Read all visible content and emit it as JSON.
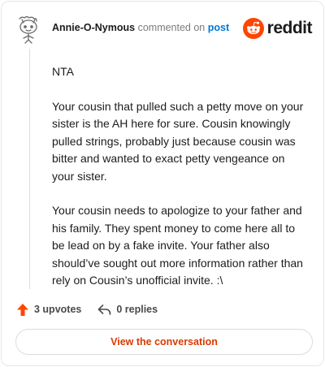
{
  "header": {
    "author": "Annie-O-Nymous",
    "action_text": "commented on",
    "post_link": "post",
    "brand": "reddit"
  },
  "comment": {
    "paragraphs": [
      "NTA",
      "Your cousin that pulled such a petty move on your sister is the AH here for sure. Cousin knowingly pulled strings, probably just because cousin was bitter and wanted to exact petty vengeance on your sister.",
      "Your cousin needs to apologize to your father and his family. They spent money to come here all to be lead on by a fake invite. Your father also should’ve sought out more information rather than rely on Cousin’s unofficial invite. :\\"
    ]
  },
  "actions": {
    "upvotes": "3 upvotes",
    "replies": "0 replies"
  },
  "footer": {
    "view_button": "View the conversation"
  },
  "colors": {
    "accent": "#ff4500",
    "link": "#0079d3",
    "button_text": "#d93a00"
  }
}
